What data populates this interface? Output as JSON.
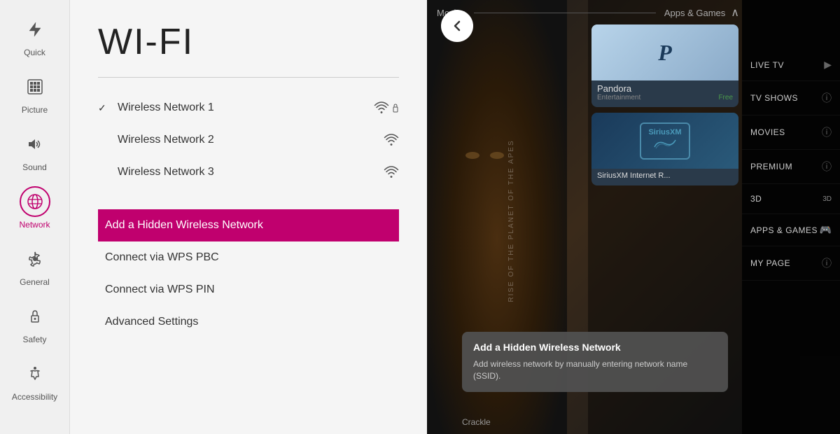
{
  "sidebar": {
    "items": [
      {
        "id": "quick",
        "label": "Quick",
        "icon": "⚡",
        "active": false
      },
      {
        "id": "picture",
        "label": "Picture",
        "icon": "⊞",
        "active": false
      },
      {
        "id": "sound",
        "label": "Sound",
        "icon": "🔊",
        "active": false
      },
      {
        "id": "network",
        "label": "Network",
        "icon": "🌐",
        "active": true
      },
      {
        "id": "general",
        "label": "General",
        "icon": "⚙",
        "active": false
      },
      {
        "id": "safety",
        "label": "Safety",
        "icon": "🔒",
        "active": false
      },
      {
        "id": "accessibility",
        "label": "Accessibility",
        "icon": "♿",
        "active": false
      }
    ]
  },
  "wifi_panel": {
    "title": "WI-FI",
    "networks": [
      {
        "id": "net1",
        "name": "Wireless Network 1",
        "selected": true,
        "locked": true
      },
      {
        "id": "net2",
        "name": "Wireless Network 2",
        "selected": false,
        "locked": false
      },
      {
        "id": "net3",
        "name": "Wireless Network 3",
        "selected": false,
        "locked": false
      }
    ],
    "actions": [
      {
        "id": "add-hidden",
        "label": "Add a Hidden Wireless Network",
        "highlighted": true
      },
      {
        "id": "wps-pbc",
        "label": "Connect via WPS PBC",
        "highlighted": false
      },
      {
        "id": "wps-pin",
        "label": "Connect via WPS PIN",
        "highlighted": false
      },
      {
        "id": "advanced",
        "label": "Advanced Settings",
        "highlighted": false
      }
    ]
  },
  "tv_panel": {
    "back_button": "↩",
    "sections": {
      "movies_label": "Movies",
      "apps_games_label": "Apps & Games"
    },
    "apps": [
      {
        "id": "pandora",
        "name": "Pandora",
        "sub": "Entertainment",
        "badge": "Free"
      },
      {
        "id": "siriusxm",
        "name": "SiriusXM Internet R...",
        "sub": "",
        "badge": ""
      }
    ],
    "nav_items": [
      {
        "id": "live-tv",
        "label": "LIVE TV",
        "icon": "▶"
      },
      {
        "id": "tv-shows",
        "label": "TV SHOWS",
        "icon": "ⓘ"
      },
      {
        "id": "movies",
        "label": "MOVIES",
        "icon": "ⓘ"
      },
      {
        "id": "premium",
        "label": "PREMIUM",
        "icon": "ⓘ"
      },
      {
        "id": "3d",
        "label": "3D",
        "icon": "3D"
      },
      {
        "id": "apps-games",
        "label": "APPS & GAMES",
        "icon": "🎮"
      },
      {
        "id": "my-page",
        "label": "MY PAGE",
        "icon": "ⓘ"
      }
    ],
    "tooltip": {
      "title": "Add a Hidden Wireless Network",
      "text": "Add wireless network by manually entering network name (SSID)."
    },
    "crackle_label": "Crackle"
  }
}
